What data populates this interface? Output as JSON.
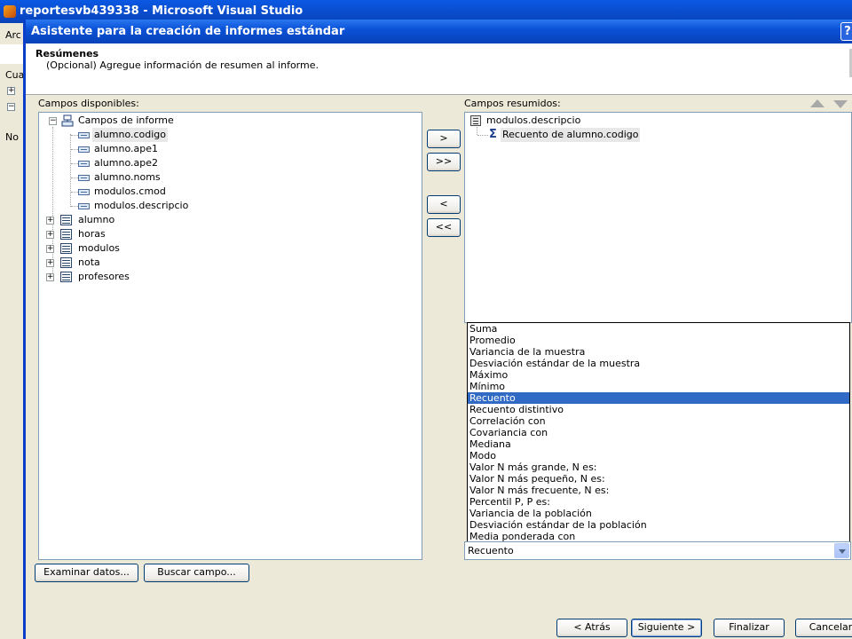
{
  "vs": {
    "title": "reportesvb439338 - Microsoft Visual Studio",
    "menu_fragment": "Arc",
    "panel_fragment": "Cuad",
    "left_text_fragment": "No"
  },
  "dialog": {
    "title": "Asistente para la creación de informes estándar",
    "help_label": "?",
    "header_title": "Resúmenes",
    "header_subtitle": "(Opcional) Agregue información de resumen al informe."
  },
  "available": {
    "label": "Campos disponibles:",
    "root": "Campos de informe",
    "fields": [
      "alumno.codigo",
      "alumno.ape1",
      "alumno.ape2",
      "alumno.noms",
      "modulos.cmod",
      "modulos.descripcio"
    ],
    "tables": [
      "alumno",
      "horas",
      "modulos",
      "nota",
      "profesores"
    ]
  },
  "transfer": {
    "add": ">",
    "add_all": ">>",
    "remove": "<",
    "remove_all": "<<"
  },
  "summarized": {
    "label": "Campos resumidos:",
    "group": "modulos.descripcio",
    "item": "Recuento de alumno.codigo"
  },
  "functions": {
    "options": [
      "Suma",
      "Promedio",
      "Variancia de la muestra",
      "Desviación estándar de la muestra",
      "Máximo",
      "Mínimo",
      "Recuento",
      "Recuento distintivo",
      "Correlación con",
      "Covariancia con",
      "Mediana",
      "Modo",
      "Valor N más grande, N es:",
      "Valor N más pequeño, N es:",
      "Valor N más frecuente, N es:",
      "Percentil P, P es:",
      "Variancia de la población",
      "Desviación estándar de la población",
      "Media ponderada con"
    ],
    "selected_index": 6,
    "combo_value": "Recuento"
  },
  "bottom": {
    "browse": "Examinar datos...",
    "find": "Buscar campo...",
    "back": "< Atrás",
    "next": "Siguiente >",
    "finish": "Finalizar",
    "cancel": "Cancelar"
  },
  "colors": {
    "selection": "#316ac5",
    "title_blue": "#0a52d8"
  }
}
